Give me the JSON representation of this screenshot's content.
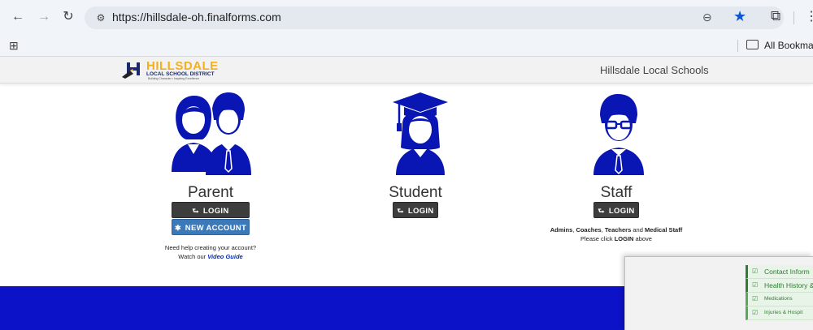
{
  "browser": {
    "url": "https://hillsdale-oh.finalforms.com",
    "bookmarks_label": "All Bookmarks"
  },
  "header": {
    "logo_text": "HILLSDALE",
    "logo_subtext": "LOCAL SCHOOL DISTRICT",
    "logo_tagline": "Building Character • Inspiring Excellence",
    "district_name": "Hillsdale Local Schools"
  },
  "sections": {
    "parent": {
      "title": "Parent",
      "login_label": "LOGIN",
      "new_account_label": "NEW ACCOUNT",
      "help_line1": "Need help creating your account?",
      "help_line2_prefix": "Watch our ",
      "help_link": "Video Guide"
    },
    "student": {
      "title": "Student",
      "login_label": "LOGIN"
    },
    "staff": {
      "title": "Staff",
      "login_label": "LOGIN",
      "note_admins": "Admins",
      "note_coaches": "Coaches",
      "note_teachers": "Teachers",
      "note_and": "and",
      "note_medical": "Medical Staff",
      "note_line2_prefix": "Please click ",
      "note_line2_bold": "LOGIN",
      "note_line2_suffix": " above"
    }
  },
  "overlay_menu": {
    "items": [
      {
        "label": "Contact Inform"
      },
      {
        "label": "Health History &"
      },
      {
        "label": "Medications"
      },
      {
        "label": "Injuries & Hospit"
      }
    ]
  },
  "colors": {
    "primary_blue": "#0c12c8",
    "login_button": "#3d3d3d",
    "new_account_button": "#3b79b8",
    "logo_gold": "#f2b01e"
  },
  "icons": {
    "back": "arrow-left-icon",
    "forward": "arrow-right-icon",
    "reload": "reload-icon",
    "bookmark": "star-icon",
    "login": "sign-in-icon",
    "new_account": "asterisk-icon"
  }
}
